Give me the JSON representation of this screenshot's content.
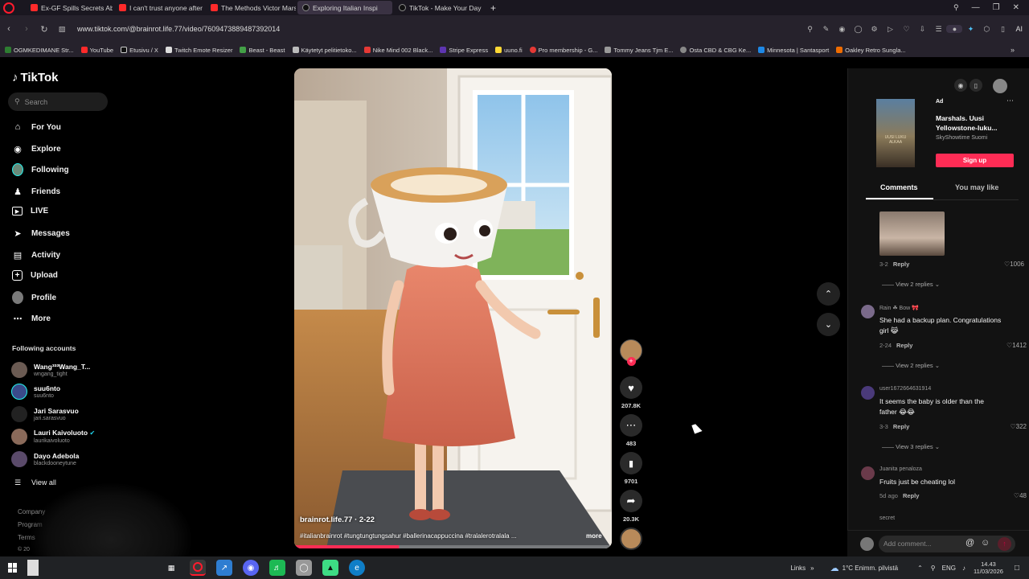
{
  "browser": {
    "tabs": [
      {
        "title": "Ex-GF Spills Secrets About",
        "active": false
      },
      {
        "title": "I can't trust anyone after th",
        "active": false
      },
      {
        "title": "The Methods Victor Mars",
        "active": false
      },
      {
        "title": "Exploring Italian Inspi",
        "active": true
      },
      {
        "title": "TikTok - Make Your Day",
        "active": false
      }
    ],
    "url": "www.tiktok.com/@brainrot.life.77/video/7609473889487392014",
    "ai_label": "AI",
    "bookmarks": [
      "OGMKEDIMANE Str...",
      "YouTube",
      "Etusivu / X",
      "Twitch Emote Resizer",
      "Beast - Beast",
      "Käytetyt pelitietoko...",
      "Nike Mind 002 Black...",
      "Stripe Express",
      "uuno.fi",
      "Pro membership - G...",
      "Tommy Jeans Tjm E...",
      "Osta CBD & CBG Ke...",
      "Minnesota | Santasport",
      "Oakley Retro Sungla..."
    ]
  },
  "sidebar": {
    "logo": "TikTok",
    "search_placeholder": "Search",
    "nav": [
      {
        "label": "For You",
        "icon": "home-icon"
      },
      {
        "label": "Explore",
        "icon": "compass-icon"
      },
      {
        "label": "Following",
        "icon": "following-avatar"
      },
      {
        "label": "Friends",
        "icon": "friends-icon"
      },
      {
        "label": "LIVE",
        "icon": "live-icon"
      },
      {
        "label": "Messages",
        "icon": "messages-icon"
      },
      {
        "label": "Activity",
        "icon": "activity-icon"
      },
      {
        "label": "Upload",
        "icon": "upload-icon"
      },
      {
        "label": "Profile",
        "icon": "profile-avatar"
      },
      {
        "label": "More",
        "icon": "more-icon"
      }
    ],
    "following_title": "Following accounts",
    "accounts": [
      {
        "name": "Wang³³³Wang_T...",
        "handle": "wngang_tight"
      },
      {
        "name": "suu6nto",
        "handle": "suu6nto"
      },
      {
        "name": "Jari Sarasvuo",
        "handle": "jari.sarasvuo"
      },
      {
        "name": "Lauri Kaivoluoto",
        "handle": "laurikaivoluoto"
      },
      {
        "name": "Dayo Adebola",
        "handle": "blackdooneytune"
      }
    ],
    "view_all": "View all",
    "footer": [
      "Company",
      "Program",
      "Terms",
      "© 20"
    ]
  },
  "video": {
    "author": "brainrot.life.77 · 2-22",
    "caption": "#italianbrainrot #tungtungtungsahur #ballerinacappuccina #tralalerotralala ...",
    "more": "more",
    "progress": 0.33
  },
  "actions": {
    "likes": "207.8K",
    "comments": "483",
    "saves": "9701",
    "shares": "20.3K"
  },
  "right_panel": {
    "ad": {
      "badge": "Ad",
      "title": "Marshals. Uusi Yellowstone-luku...",
      "advertiser": "SkyShowtime Suomi",
      "cta": "Sign up",
      "thumb_text": "UUSI LUKU ALKAA"
    },
    "tabs": [
      "Comments",
      "You may like"
    ],
    "top_comment_meta": {
      "date": "3-2",
      "reply": "Reply",
      "likes": "1006",
      "view_replies": "View 2 replies"
    },
    "comments": [
      {
        "user": "Rain ☘ Bow 🎀",
        "text": "She had a backup plan. Congratulations girl 😹",
        "date": "2-24",
        "reply": "Reply",
        "likes": "1412",
        "view_replies": "View 2 replies"
      },
      {
        "user": "user1672664631914",
        "text": "It seems the baby is older than the father 😂😂",
        "date": "3-3",
        "reply": "Reply",
        "likes": "322",
        "view_replies": "View 3 replies"
      },
      {
        "user": "Juanita penaloza",
        "text": "Fruits just be cheating lol",
        "date": "5d ago",
        "reply": "Reply",
        "likes": "48"
      },
      {
        "user": "secret",
        "text": ""
      }
    ],
    "comment_placeholder": "Add comment..."
  },
  "taskbar": {
    "links": "Links",
    "weather": "1°C  Enimm. pilvistä",
    "lang": "ENG",
    "time": "14.43",
    "date": "11/03/2026"
  }
}
